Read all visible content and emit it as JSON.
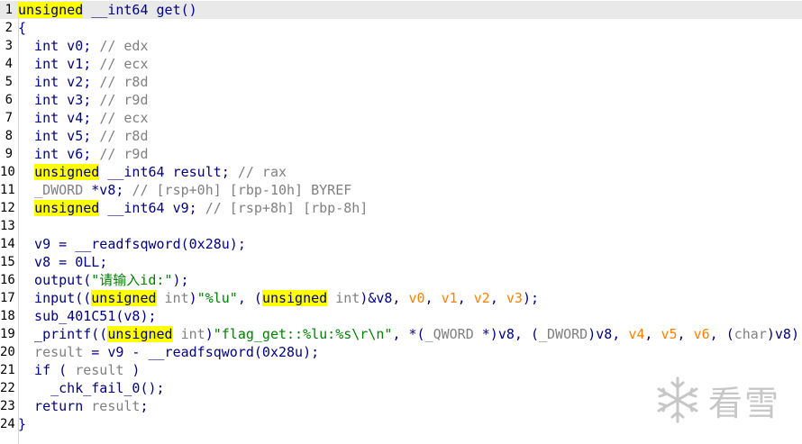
{
  "editor": {
    "lines": [
      {
        "no": "1",
        "current": true,
        "tokens": [
          [
            "hl",
            "unsigned"
          ],
          [
            "t",
            " __int64 get()"
          ]
        ]
      },
      {
        "no": "2",
        "tokens": [
          [
            "t",
            "{"
          ]
        ]
      },
      {
        "no": "3",
        "tokens": [
          [
            "t",
            "  int v0; "
          ],
          [
            "c",
            "// edx"
          ]
        ]
      },
      {
        "no": "4",
        "tokens": [
          [
            "t",
            "  int v1; "
          ],
          [
            "c",
            "// ecx"
          ]
        ]
      },
      {
        "no": "5",
        "tokens": [
          [
            "t",
            "  int v2; "
          ],
          [
            "c",
            "// r8d"
          ]
        ]
      },
      {
        "no": "6",
        "tokens": [
          [
            "t",
            "  int v3; "
          ],
          [
            "c",
            "// r9d"
          ]
        ]
      },
      {
        "no": "7",
        "tokens": [
          [
            "t",
            "  int v4; "
          ],
          [
            "c",
            "// ecx"
          ]
        ]
      },
      {
        "no": "8",
        "tokens": [
          [
            "t",
            "  int v5; "
          ],
          [
            "c",
            "// r8d"
          ]
        ]
      },
      {
        "no": "9",
        "tokens": [
          [
            "t",
            "  int v6; "
          ],
          [
            "c",
            "// r9d"
          ]
        ]
      },
      {
        "no": "10",
        "tokens": [
          [
            "t",
            "  "
          ],
          [
            "hl",
            "unsigned"
          ],
          [
            "t",
            " __int64 result; "
          ],
          [
            "c",
            "// rax"
          ]
        ]
      },
      {
        "no": "11",
        "tokens": [
          [
            "t",
            "  "
          ],
          [
            "g",
            "_DWORD"
          ],
          [
            "t",
            " *v8; "
          ],
          [
            "c",
            "// [rsp+0h] [rbp-10h] BYREF"
          ]
        ]
      },
      {
        "no": "12",
        "tokens": [
          [
            "t",
            "  "
          ],
          [
            "hl",
            "unsigned"
          ],
          [
            "t",
            " __int64 v9; "
          ],
          [
            "c",
            "// [rsp+8h] [rbp-8h]"
          ]
        ]
      },
      {
        "no": "13",
        "tokens": []
      },
      {
        "no": "14",
        "tokens": [
          [
            "t",
            "  v9 = __readfsqword(0x28u);"
          ]
        ]
      },
      {
        "no": "15",
        "tokens": [
          [
            "t",
            "  v8 = 0LL;"
          ]
        ]
      },
      {
        "no": "16",
        "tokens": [
          [
            "t",
            "  output("
          ],
          [
            "s",
            "\"请输入id:\""
          ],
          [
            "t",
            ");"
          ]
        ]
      },
      {
        "no": "17",
        "tokens": [
          [
            "t",
            "  input(("
          ],
          [
            "hl",
            "unsigned"
          ],
          [
            "g",
            " int"
          ],
          [
            "t",
            ")"
          ],
          [
            "s",
            "\"%lu\""
          ],
          [
            "t",
            ", ("
          ],
          [
            "hl",
            "unsigned"
          ],
          [
            "g",
            " int"
          ],
          [
            "t",
            ")&v8, "
          ],
          [
            "a",
            "v0"
          ],
          [
            "t",
            ", "
          ],
          [
            "a",
            "v1"
          ],
          [
            "t",
            ", "
          ],
          [
            "a",
            "v2"
          ],
          [
            "t",
            ", "
          ],
          [
            "a",
            "v3"
          ],
          [
            "t",
            ");"
          ]
        ]
      },
      {
        "no": "18",
        "tokens": [
          [
            "t",
            "  sub_401C51(v8);"
          ]
        ]
      },
      {
        "no": "19",
        "tokens": [
          [
            "t",
            "  _printf(("
          ],
          [
            "hl",
            "unsigned"
          ],
          [
            "g",
            " int"
          ],
          [
            "t",
            ")"
          ],
          [
            "s",
            "\"flag_get::%lu:%s\\r\\n\""
          ],
          [
            "t",
            ", *("
          ],
          [
            "g",
            "_QWORD"
          ],
          [
            "t",
            " *)v8, ("
          ],
          [
            "g",
            "_DWORD"
          ],
          [
            "t",
            ")v8, "
          ],
          [
            "a",
            "v4"
          ],
          [
            "t",
            ", "
          ],
          [
            "a",
            "v5"
          ],
          [
            "t",
            ", "
          ],
          [
            "a",
            "v6"
          ],
          [
            "t",
            ", ("
          ],
          [
            "g",
            "char"
          ],
          [
            "t",
            ")v8);"
          ]
        ]
      },
      {
        "no": "20",
        "tokens": [
          [
            "g",
            "  result"
          ],
          [
            "t",
            " = v9 - __readfsqword(0x28u);"
          ]
        ]
      },
      {
        "no": "21",
        "tokens": [
          [
            "t",
            "  if ( "
          ],
          [
            "g",
            "result"
          ],
          [
            "t",
            " )"
          ]
        ]
      },
      {
        "no": "22",
        "tokens": [
          [
            "t",
            "    _chk_fail_0();"
          ]
        ]
      },
      {
        "no": "23",
        "tokens": [
          [
            "t",
            "  return "
          ],
          [
            "g",
            "result"
          ],
          [
            "t",
            ";"
          ]
        ]
      },
      {
        "no": "24",
        "tokens": [
          [
            "t",
            "}"
          ]
        ]
      }
    ]
  },
  "watermark": {
    "text": "看雪",
    "icon": "snowflake-logo-icon"
  },
  "colors": {
    "highlight": "#ffff00",
    "code": "#000080",
    "comment": "#808080",
    "string": "#008000",
    "arg": "#FF8000"
  }
}
